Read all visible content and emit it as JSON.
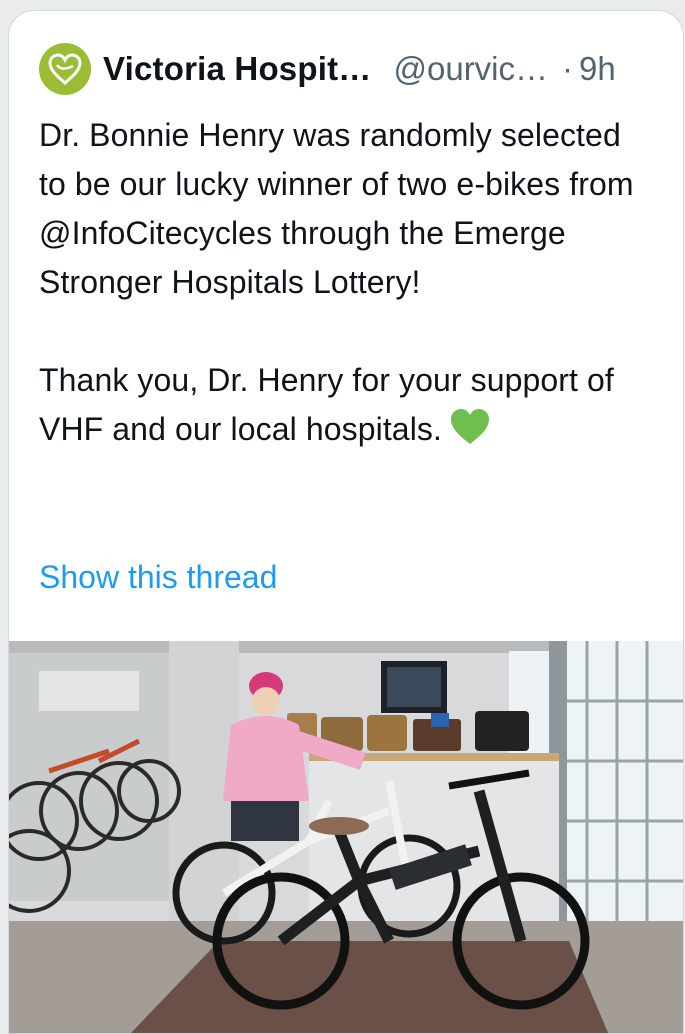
{
  "tweet": {
    "author_name": "Victoria Hospit…",
    "author_handle": "@ourvic…",
    "separator": "·",
    "time": "9h",
    "paragraph_1": "Dr. Bonnie Henry was randomly selected to be our lucky winner of two e-bikes from @InfoCitecycles through the Emerge Stronger Hospitals Lottery!",
    "paragraph_2": "Thank you, Dr. Henry for your support of VHF and our local hospitals.",
    "emoji": "green-heart-icon",
    "show_thread": "Show this thread"
  },
  "colors": {
    "avatar": "#9bbd35",
    "link": "#1d9bf0",
    "heart": "#6fbf4f",
    "muted": "#536471"
  }
}
